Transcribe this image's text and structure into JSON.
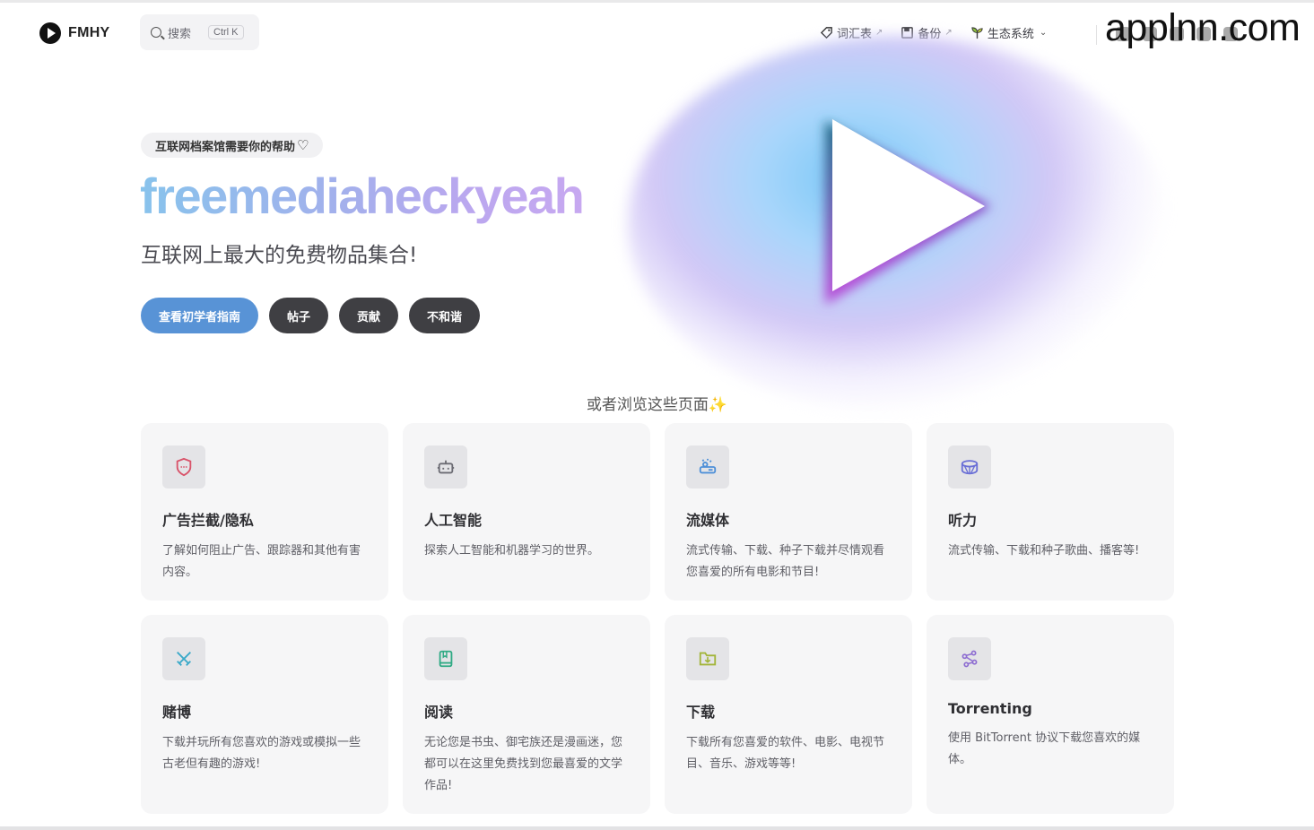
{
  "nav": {
    "brand": "FMHY",
    "search_placeholder": "搜索",
    "search_shortcut": "Ctrl K",
    "links": [
      {
        "label": "词汇表",
        "icon": "tag-icon",
        "external": "↗"
      },
      {
        "label": "备份",
        "icon": "floppy-icon",
        "external": "↗"
      },
      {
        "label": "生态系统",
        "icon": "sprout-icon",
        "chevron": "⌄"
      }
    ],
    "watermark": "applnn.com"
  },
  "hero": {
    "notice": "互联网档案馆需要你的帮助",
    "heart": "♡",
    "title": "freemediaheckyeah",
    "subtitle": "互联网上最大的免费物品集合!",
    "actions": [
      {
        "label": "查看初学者指南",
        "style": "primary"
      },
      {
        "label": "帖子",
        "style": "secondary"
      },
      {
        "label": "贡献",
        "style": "secondary"
      },
      {
        "label": "不和谐",
        "style": "secondary"
      }
    ]
  },
  "browse": {
    "heading": "或者浏览这些页面",
    "sparkle": "✨"
  },
  "cards": [
    {
      "title": "广告拦截/隐私",
      "desc": "了解如何阻止广告、跟踪器和其他有害内容。",
      "icon": "shield-icon",
      "color": "#d9536a"
    },
    {
      "title": "人工智能",
      "desc": "探索人工智能和机器学习的世界。",
      "icon": "robot-icon",
      "color": "#6b6b73"
    },
    {
      "title": "流媒体",
      "desc": "流式传输、下载、种子下载并尽情观看您喜爱的所有电影和节目!",
      "icon": "tv-icon",
      "color": "#4d8fd8"
    },
    {
      "title": "听力",
      "desc": "流式传输、下载和种子歌曲、播客等!",
      "icon": "drum-icon",
      "color": "#6a6fd6"
    },
    {
      "title": "赌博",
      "desc": "下载并玩所有您喜欢的游戏或模拟一些古老但有趣的游戏!",
      "icon": "swords-icon",
      "color": "#3aa9c9"
    },
    {
      "title": "阅读",
      "desc": "无论您是书虫、御宅族还是漫画迷，您都可以在这里免费找到您最喜爱的文学作品!",
      "icon": "book-icon",
      "color": "#2faa84"
    },
    {
      "title": "下载",
      "desc": "下载所有您喜爱的软件、电影、电视节目、音乐、游戏等等!",
      "icon": "folder-download-icon",
      "color": "#a2b53a"
    },
    {
      "title": "Torrenting",
      "desc": "使用 BitTorrent 协议下载您喜欢的媒体。",
      "icon": "network-icon",
      "color": "#8c6bd1"
    }
  ]
}
